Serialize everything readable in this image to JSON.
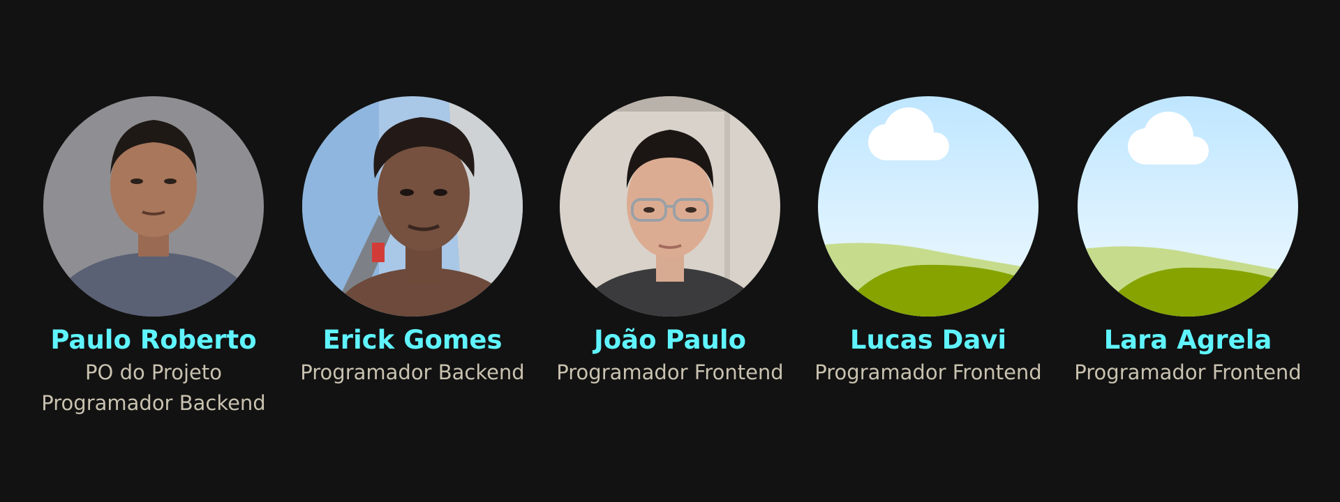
{
  "members": [
    {
      "name": "Paulo Roberto",
      "roles": [
        "PO do Projeto",
        "Programador Backend"
      ],
      "avatar_icon": "person-photo"
    },
    {
      "name": "Erick Gomes",
      "roles": [
        "Programador Backend"
      ],
      "avatar_icon": "person-photo"
    },
    {
      "name": "João Paulo",
      "roles": [
        "Programador Frontend"
      ],
      "avatar_icon": "person-photo"
    },
    {
      "name": "Lucas Davi",
      "roles": [
        "Programador Frontend"
      ],
      "avatar_icon": "landscape-placeholder-icon"
    },
    {
      "name": "Lara Agrela",
      "roles": [
        "Programador Frontend"
      ],
      "avatar_icon": "landscape-placeholder-icon"
    }
  ],
  "colors": {
    "background": "#121212",
    "name": "#5ff4ff",
    "role": "#c9c2b0"
  }
}
